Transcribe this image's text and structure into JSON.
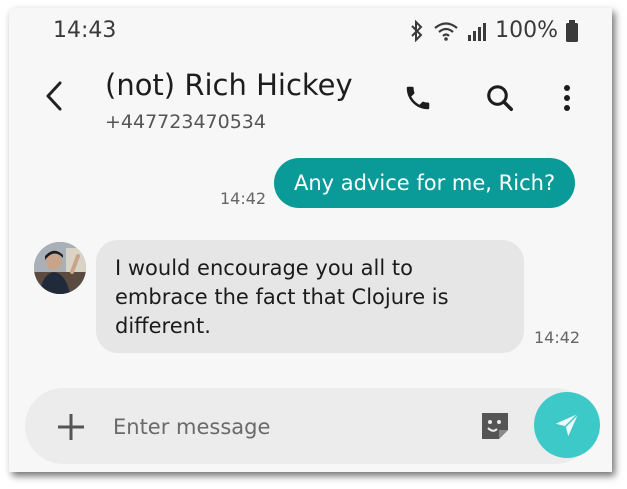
{
  "status_bar": {
    "time": "14:43",
    "battery_text": "100%",
    "icons": [
      "bluetooth-icon",
      "wifi-icon",
      "signal-icon",
      "battery-icon"
    ]
  },
  "header": {
    "contact_name": "(not) Rich Hickey",
    "phone_number": "+447723470534",
    "icons": [
      "back-icon",
      "phone-icon",
      "search-icon",
      "more-icon"
    ]
  },
  "messages": [
    {
      "direction": "outgoing",
      "text": "Any advice for me, Rich?",
      "time": "14:42"
    },
    {
      "direction": "incoming",
      "text": "I would encourage you all to embrace the fact that Clojure is different.",
      "time": "14:42"
    }
  ],
  "composer": {
    "placeholder": "Enter message",
    "icons": [
      "plus-icon",
      "sticker-icon",
      "send-icon"
    ]
  },
  "colors": {
    "outgoing_bubble": "#0a9b98",
    "incoming_bubble": "#e6e6e6",
    "send_button": "#3cc9c7",
    "background": "#f7f7f7"
  }
}
